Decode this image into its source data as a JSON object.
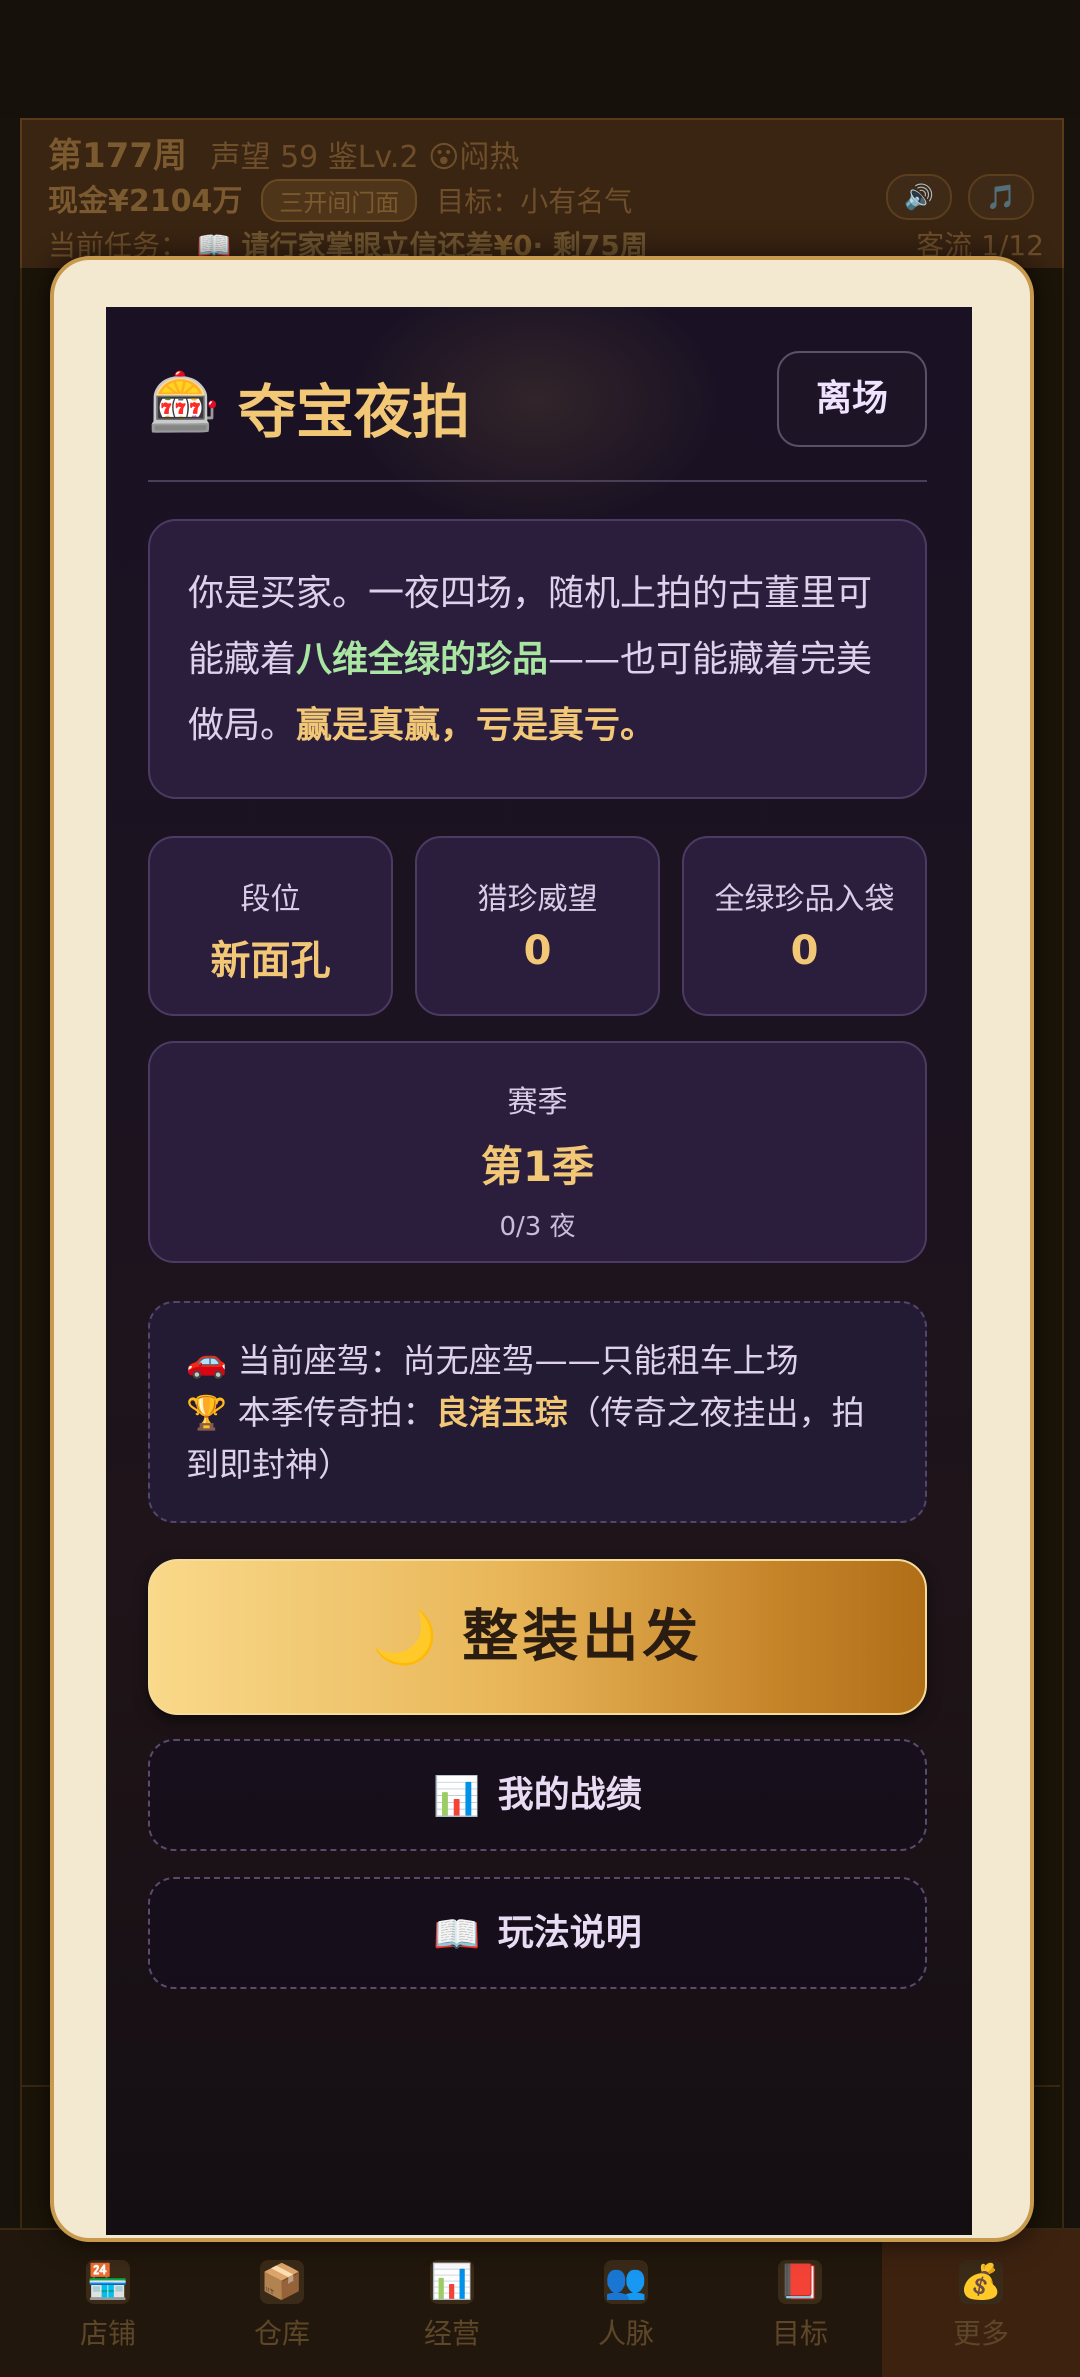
{
  "hud": {
    "week": "第177周",
    "reputation": "声望 59",
    "appraisal": "鉴Lv.2",
    "mood_icon": "😮",
    "mood": "闷热",
    "cash": "现金¥2104万",
    "shop_chip": "三开间门面",
    "goal": "目标：小有名气",
    "task_prefix": "当前任务：",
    "task_icon": "📖",
    "task": "请行家掌眼立信还差",
    "task_gap": "¥0",
    "task_remaining": "· 剩75周",
    "customer_flow": "客流 1/12",
    "sound_icon": "🔊",
    "music_icon": "🎵"
  },
  "tabs": [
    {
      "icon": "🏪",
      "label": "店铺",
      "icon_name": "shop-icon"
    },
    {
      "icon": "📦",
      "label": "仓库",
      "icon_name": "warehouse-icon"
    },
    {
      "icon": "📊",
      "label": "经营",
      "icon_name": "business-icon"
    },
    {
      "icon": "👥",
      "label": "人脉",
      "icon_name": "contacts-icon"
    },
    {
      "icon": "📕",
      "label": "目标",
      "icon_name": "goal-icon"
    },
    {
      "icon": "💰",
      "label": "更多",
      "icon_name": "more-icon"
    }
  ],
  "modal": {
    "title_icon": "🎰",
    "title": "夺宝夜拍",
    "leave_label": "离场",
    "intro": {
      "part1": "你是买家。一夜四场，随机上拍的古董里可能藏着",
      "highlight1": "八维全绿的珍品",
      "part2": "——也可能藏着完美做局。",
      "highlight2": "赢是真赢，亏是真亏。"
    },
    "stats": [
      {
        "label": "段位",
        "value": "新面孔"
      },
      {
        "label": "猎珍威望",
        "value": "0"
      },
      {
        "label": "全绿珍品入袋",
        "value": "0"
      }
    ],
    "season": {
      "label": "赛季",
      "value": "第1季",
      "progress": "0/3 夜"
    },
    "info": {
      "car_icon": "🚗",
      "car_text": "当前座驾：尚无座驾——只能租车上场",
      "trophy_icon": "🏆",
      "legend_prefix": "本季传奇拍：",
      "legend_item": "良渚玉琮",
      "legend_suffix": "（传奇之夜挂出，拍到即封神）"
    },
    "depart_icon": "🌙",
    "depart_label": "整装出发",
    "record_icon": "📊",
    "record_label": "我的战绩",
    "rules_icon": "📖",
    "rules_label": "玩法说明"
  }
}
